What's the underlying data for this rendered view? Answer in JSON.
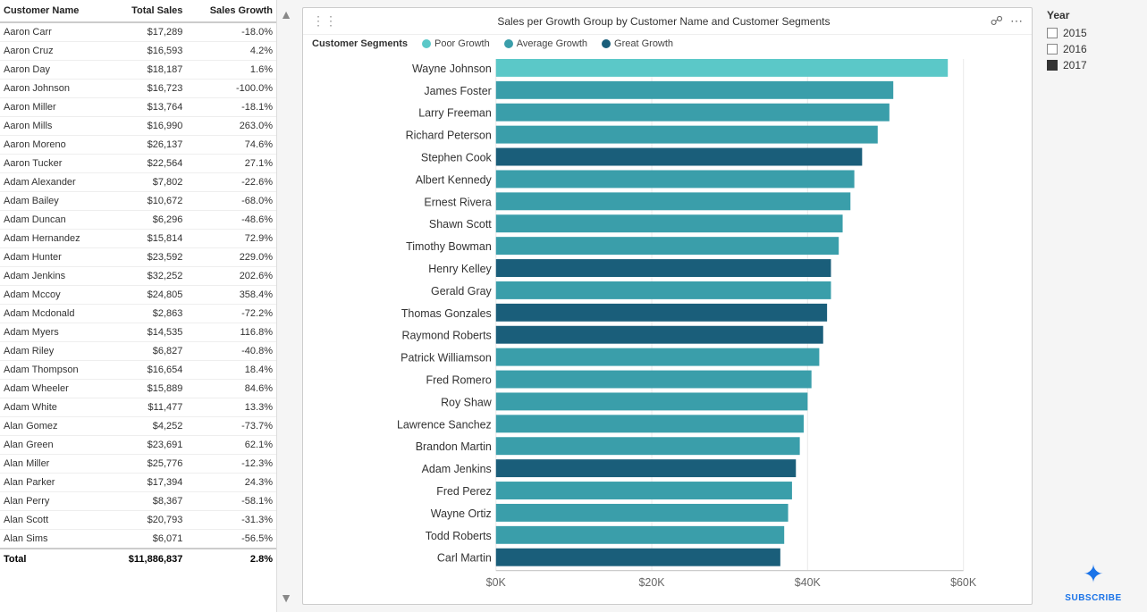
{
  "table": {
    "headers": [
      "Customer Name",
      "Total Sales",
      "Sales Growth"
    ],
    "rows": [
      [
        "Aaron Carr",
        "$17,289",
        "-18.0%"
      ],
      [
        "Aaron Cruz",
        "$16,593",
        "4.2%"
      ],
      [
        "Aaron Day",
        "$18,187",
        "1.6%"
      ],
      [
        "Aaron Johnson",
        "$16,723",
        "-100.0%"
      ],
      [
        "Aaron Miller",
        "$13,764",
        "-18.1%"
      ],
      [
        "Aaron Mills",
        "$16,990",
        "263.0%"
      ],
      [
        "Aaron Moreno",
        "$26,137",
        "74.6%"
      ],
      [
        "Aaron Tucker",
        "$22,564",
        "27.1%"
      ],
      [
        "Adam Alexander",
        "$7,802",
        "-22.6%"
      ],
      [
        "Adam Bailey",
        "$10,672",
        "-68.0%"
      ],
      [
        "Adam Duncan",
        "$6,296",
        "-48.6%"
      ],
      [
        "Adam Hernandez",
        "$15,814",
        "72.9%"
      ],
      [
        "Adam Hunter",
        "$23,592",
        "229.0%"
      ],
      [
        "Adam Jenkins",
        "$32,252",
        "202.6%"
      ],
      [
        "Adam Mccoy",
        "$24,805",
        "358.4%"
      ],
      [
        "Adam Mcdonald",
        "$2,863",
        "-72.2%"
      ],
      [
        "Adam Myers",
        "$14,535",
        "116.8%"
      ],
      [
        "Adam Riley",
        "$6,827",
        "-40.8%"
      ],
      [
        "Adam Thompson",
        "$16,654",
        "18.4%"
      ],
      [
        "Adam Wheeler",
        "$15,889",
        "84.6%"
      ],
      [
        "Adam White",
        "$11,477",
        "13.3%"
      ],
      [
        "Alan Gomez",
        "$4,252",
        "-73.7%"
      ],
      [
        "Alan Green",
        "$23,691",
        "62.1%"
      ],
      [
        "Alan Miller",
        "$25,776",
        "-12.3%"
      ],
      [
        "Alan Parker",
        "$17,394",
        "24.3%"
      ],
      [
        "Alan Perry",
        "$8,367",
        "-58.1%"
      ],
      [
        "Alan Scott",
        "$20,793",
        "-31.3%"
      ],
      [
        "Alan Sims",
        "$6,071",
        "-56.5%"
      ]
    ],
    "footer": [
      "Total",
      "$11,886,837",
      "2.8%"
    ]
  },
  "chart": {
    "title": "Sales per Growth Group by Customer Name and Customer Segments",
    "legend_label": "Customer Segments",
    "legend_items": [
      {
        "label": "Poor Growth",
        "color": "#5bc8c8"
      },
      {
        "label": "Average Growth",
        "color": "#3a9eaa"
      },
      {
        "label": "Great Growth",
        "color": "#1a5e7a"
      }
    ],
    "bars": [
      {
        "name": "Wayne Johnson",
        "value": 58000,
        "segment": "Poor Growth"
      },
      {
        "name": "James Foster",
        "value": 51000,
        "segment": "Average Growth"
      },
      {
        "name": "Larry Freeman",
        "value": 50500,
        "segment": "Average Growth"
      },
      {
        "name": "Richard Peterson",
        "value": 49000,
        "segment": "Average Growth"
      },
      {
        "name": "Stephen Cook",
        "value": 47000,
        "segment": "Great Growth"
      },
      {
        "name": "Albert Kennedy",
        "value": 46000,
        "segment": "Average Growth"
      },
      {
        "name": "Ernest Rivera",
        "value": 45500,
        "segment": "Average Growth"
      },
      {
        "name": "Shawn Scott",
        "value": 44500,
        "segment": "Average Growth"
      },
      {
        "name": "Timothy Bowman",
        "value": 44000,
        "segment": "Average Growth"
      },
      {
        "name": "Henry Kelley",
        "value": 43000,
        "segment": "Great Growth"
      },
      {
        "name": "Gerald Gray",
        "value": 43000,
        "segment": "Average Growth"
      },
      {
        "name": "Thomas Gonzales",
        "value": 42500,
        "segment": "Great Growth"
      },
      {
        "name": "Raymond Roberts",
        "value": 42000,
        "segment": "Great Growth"
      },
      {
        "name": "Patrick Williamson",
        "value": 41500,
        "segment": "Average Growth"
      },
      {
        "name": "Fred Romero",
        "value": 40500,
        "segment": "Average Growth"
      },
      {
        "name": "Roy Shaw",
        "value": 40000,
        "segment": "Average Growth"
      },
      {
        "name": "Lawrence Sanchez",
        "value": 39500,
        "segment": "Average Growth"
      },
      {
        "name": "Brandon Martin",
        "value": 39000,
        "segment": "Average Growth"
      },
      {
        "name": "Adam Jenkins",
        "value": 38500,
        "segment": "Great Growth"
      },
      {
        "name": "Fred Perez",
        "value": 38000,
        "segment": "Average Growth"
      },
      {
        "name": "Wayne Ortiz",
        "value": 37500,
        "segment": "Average Growth"
      },
      {
        "name": "Todd Roberts",
        "value": 37000,
        "segment": "Average Growth"
      },
      {
        "name": "Carl Martin",
        "value": 36500,
        "segment": "Great Growth"
      }
    ],
    "x_axis": [
      "$0K",
      "$20K",
      "$40K",
      "$60K"
    ],
    "x_axis_max": 60000
  },
  "year_filter": {
    "label": "Year",
    "years": [
      {
        "value": "2015",
        "checked": false
      },
      {
        "value": "2016",
        "checked": false
      },
      {
        "value": "2017",
        "checked": true
      }
    ]
  },
  "subscribe": {
    "text": "SUBSCRIBE"
  }
}
